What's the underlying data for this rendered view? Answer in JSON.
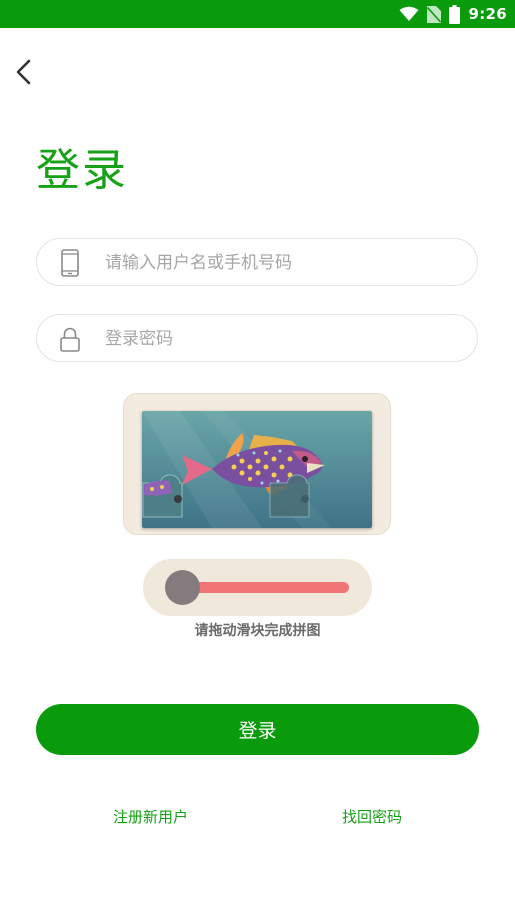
{
  "status_bar": {
    "time": "9:26"
  },
  "page": {
    "title": "登录"
  },
  "form": {
    "username_placeholder": "请输入用户名或手机号码",
    "password_placeholder": "登录密码"
  },
  "captcha": {
    "hint": "请拖动滑块完成拼图"
  },
  "actions": {
    "login_label": "登录",
    "register_label": "注册新用户",
    "forgot_label": "找回密码"
  },
  "colors": {
    "brand": "#0a9b0c",
    "title_green": "#16a116",
    "slider_bar": "#f07575",
    "slider_handle": "#847b7e",
    "captcha_bg": "#f3ebe0"
  }
}
